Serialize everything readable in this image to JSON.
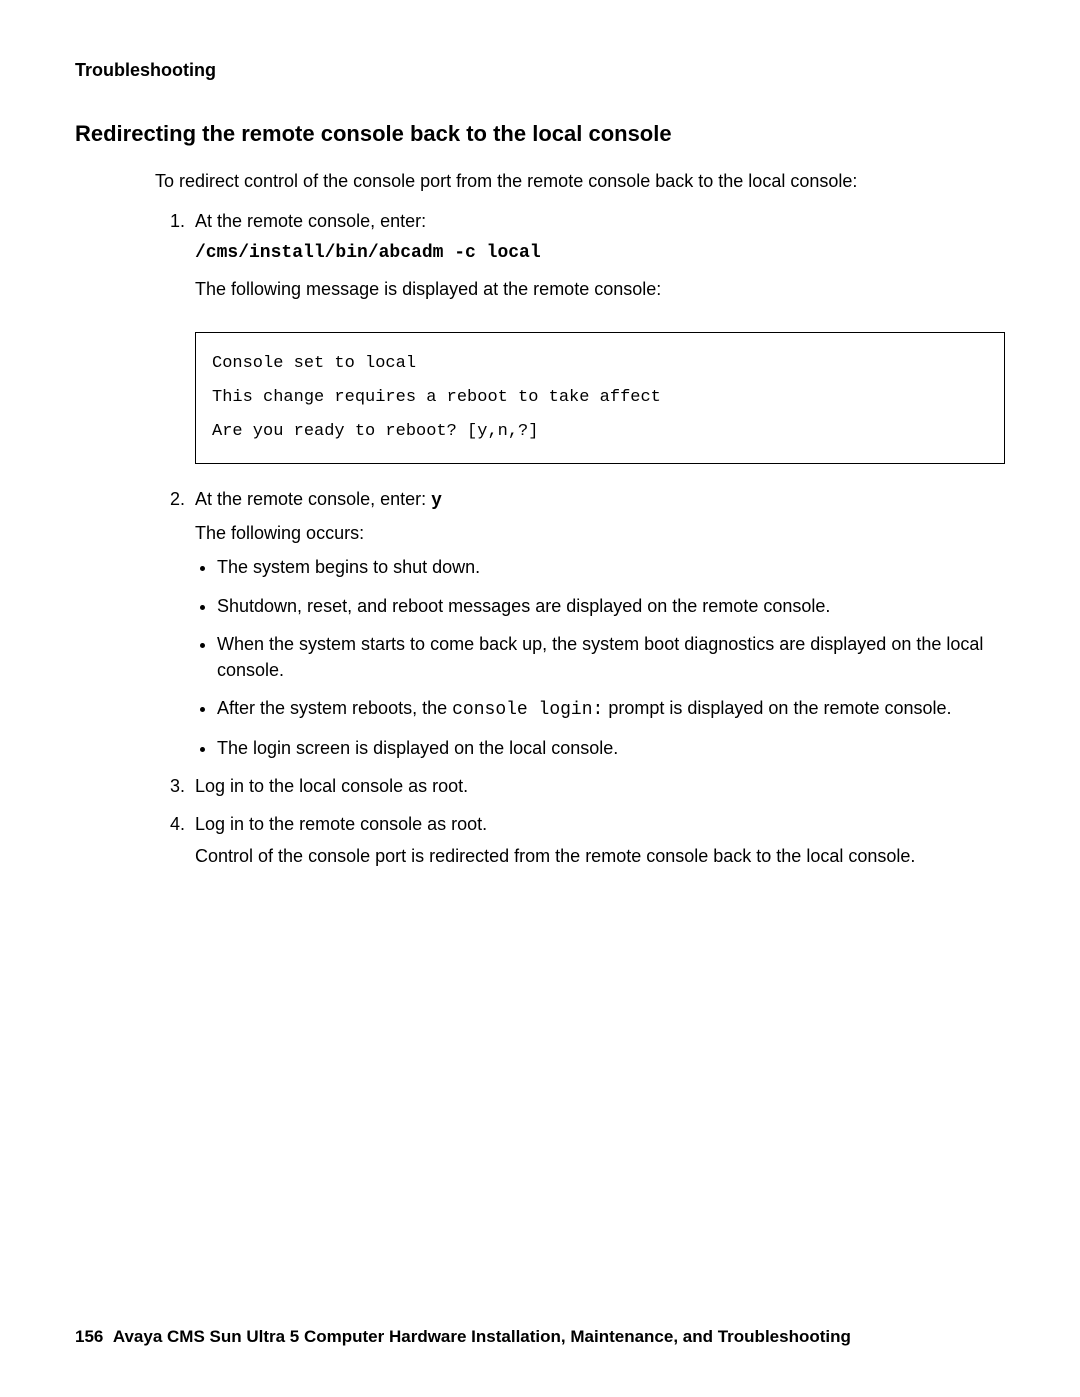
{
  "header": "Troubleshooting",
  "title": "Redirecting the remote console back to the local console",
  "intro": "To redirect control of the console port from the remote console back to the local console:",
  "steps": {
    "s1_num": "1.",
    "s1_text": "At the remote console, enter:",
    "s1_cmd": "/cms/install/bin/abcadm -c local",
    "s1_after": "The following message is displayed at the remote console:",
    "s1_box_l1": "Console set to local",
    "s1_box_l2": "This change requires a reboot to take affect",
    "s1_box_l3": "Are you ready to reboot? [y,n,?]",
    "s2_num": "2.",
    "s2_text_a": "At the remote console, enter: ",
    "s2_text_b": "y",
    "s2_after": "The following occurs:",
    "b1": "The system begins to shut down.",
    "b2": "Shutdown, reset, and reboot messages are displayed on the remote console.",
    "b3": "When the system starts to come back up, the system boot diagnostics are displayed on the local console.",
    "b4_a": "After the system reboots, the ",
    "b4_b": "console login:",
    "b4_c": " prompt is displayed on the remote console.",
    "b5": "The login screen is displayed on the local console.",
    "s3_num": "3.",
    "s3_text": "Log in to the local console as root.",
    "s4_num": "4.",
    "s4_text": "Log in to the remote console as root.",
    "s4_after": "Control of the console port is redirected from the remote console back to the local console."
  },
  "footer_page": "156",
  "footer_text": "Avaya CMS Sun Ultra 5 Computer Hardware Installation, Maintenance, and Troubleshooting"
}
